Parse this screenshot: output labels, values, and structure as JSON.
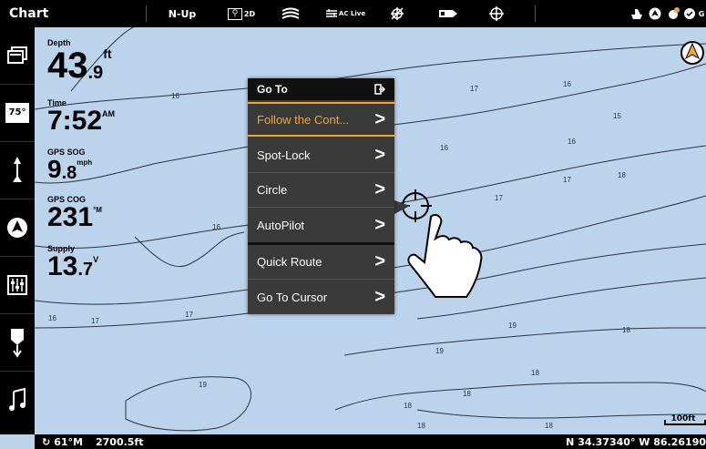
{
  "topbar": {
    "title": "Chart",
    "orientation": "N-Up",
    "view_2d": "2D",
    "aclive": "AC Live"
  },
  "data_boxes": [
    {
      "label": "Depth",
      "value": "43",
      "decimal": ".9",
      "unit": "ft"
    },
    {
      "label": "Time",
      "value": "7:52",
      "decimal": "",
      "unit": "AM"
    },
    {
      "label": "GPS SOG",
      "value": "9",
      "decimal": ".8",
      "unit": "mph"
    },
    {
      "label": "GPS COG",
      "value": "231",
      "decimal": "",
      "unit": "°M"
    },
    {
      "label": "Supply",
      "value": "13",
      "decimal": ".7",
      "unit": "V"
    }
  ],
  "sidebar": {
    "temp_label": "75°"
  },
  "menu": {
    "title": "Go To",
    "items": [
      {
        "label": "Follow the Cont...",
        "active": true
      },
      {
        "label": "Spot-Lock"
      },
      {
        "label": "Circle"
      },
      {
        "label": "AutoPilot"
      },
      {
        "label": "Quick Route"
      },
      {
        "label": "Go To Cursor"
      }
    ],
    "chevron": ">"
  },
  "bottombar": {
    "heading": "61°M",
    "distance": "2700.5ft",
    "position": "N 34.37340° W 86.26190",
    "scale": "100ft"
  },
  "contours": {
    "labels": [
      "16",
      "17",
      "18",
      "19",
      "15"
    ]
  },
  "colors": {
    "water": "#bcd3ec",
    "accent": "#f3a530"
  }
}
